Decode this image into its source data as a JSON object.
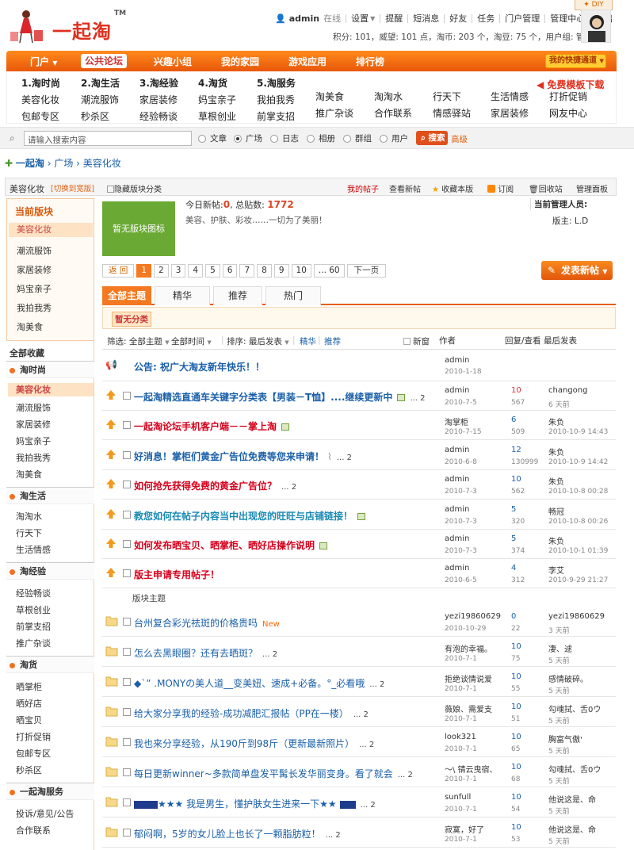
{
  "diy": "DIY",
  "logo": {
    "text": "一起淘",
    "tm": "TM"
  },
  "topbar": {
    "username": "admin",
    "status": "在线",
    "links": [
      "设置",
      "提醒",
      "短消息",
      "好友",
      "任务",
      "门户管理",
      "管理中心",
      "退出"
    ]
  },
  "userline": "积分: 101，威望: 101 点，淘币: 203 个，淘豆: 75 个，用户组: 管理员",
  "nav": {
    "items": [
      "门户",
      "公共论坛",
      "兴趣小组",
      "我的家园",
      "游戏应用",
      "排行榜"
    ],
    "quick": "我的快捷通道"
  },
  "subnav": {
    "cols": [
      {
        "title": "1.淘时尚",
        "items": [
          "美容化妆",
          "包邮专区"
        ]
      },
      {
        "title": "2.淘生活",
        "items": [
          "潮流服饰",
          "秒杀区"
        ]
      },
      {
        "title": "3.淘经验",
        "items": [
          "家居装修",
          "经验畅谈"
        ]
      },
      {
        "title": "4.淘货",
        "items": [
          "妈宝亲子",
          "草根创业"
        ]
      },
      {
        "title": "5.淘服务",
        "items": [
          "我拍我秀",
          "前掌支招"
        ]
      },
      {
        "title": "",
        "items": [
          "淘美食",
          "推广杂谈"
        ]
      },
      {
        "title": "",
        "items": [
          "淘淘水",
          "合作联系"
        ]
      },
      {
        "title": "",
        "items": [
          "行天下",
          "情感驿站"
        ]
      },
      {
        "title": "",
        "items": [
          "生活情感",
          "家居装修"
        ]
      },
      {
        "title": "",
        "items": [
          "打折促销",
          "网友中心"
        ]
      }
    ],
    "freetpl": "免费模板下载"
  },
  "search": {
    "placeholder": "请输入搜索内容",
    "options": [
      "文章",
      "广场",
      "日志",
      "相册",
      "群组",
      "用户"
    ],
    "selected": "广场",
    "button": "搜索",
    "adv": "高级"
  },
  "breadcrumb": {
    "home": "一起淘",
    "parts": [
      "广场",
      "美容化妆"
    ]
  },
  "board": {
    "name": "美容化妆",
    "switch": "[切换到宽版]",
    "hide": "隐藏版块分类",
    "links": [
      "我的帖子",
      "查看新帖",
      "收藏本版",
      "订阅",
      "回收站",
      "管理面板"
    ]
  },
  "left": {
    "cur_title": "当前版块",
    "cur_items": [
      "美容化妆",
      "潮流服饰",
      "家居装修",
      "妈宝亲子",
      "我拍我秀",
      "淘美食"
    ],
    "fav": "全部收藏",
    "sections": [
      {
        "name": "淘时尚",
        "items": [
          "美容化妆",
          "潮流服饰",
          "家居装修",
          "妈宝亲子",
          "我拍我秀",
          "淘美食"
        ]
      },
      {
        "name": "淘生活",
        "items": [
          "淘淘水",
          "行天下",
          "生活情感"
        ]
      },
      {
        "name": "淘经验",
        "items": [
          "经验畅谈",
          "草根创业",
          "前掌支招",
          "推广杂谈"
        ]
      },
      {
        "name": "淘货",
        "items": [
          "晒掌柜",
          "晒好店",
          "晒宝贝",
          "打折促销",
          "包邮专区",
          "秒杀区"
        ]
      },
      {
        "name": "一起淘服务",
        "items": [
          "投诉/意见/公告",
          "合作联系"
        ]
      }
    ]
  },
  "forum": {
    "logo_text": "暂无版块图标",
    "today_label": "今日新帖:",
    "today": "0",
    "total_label": ", 总贴数:",
    "total": "1772",
    "desc": "美容、护肤、彩妆……一切为了美丽！",
    "admins_title": "当前管理人员:",
    "admins": "版主: L.D"
  },
  "pager": {
    "prev": "返 回",
    "pages": [
      "1",
      "2",
      "3",
      "4",
      "5",
      "6",
      "7",
      "8",
      "9",
      "10",
      "... 60"
    ],
    "next": "下一页",
    "current": "1"
  },
  "newpost": "发表新帖",
  "tabs": [
    "全部主题",
    "精华",
    "推荐",
    "热门"
  ],
  "noclass": "暂无分类",
  "filter": {
    "f1": "筛选: 全部主题",
    "f2": "全部时间",
    "sort": "排序: 最后发表",
    "jh": "精华",
    "tj": "推荐",
    "newwin": "新窗",
    "author": "作者",
    "replies": "回复/查看",
    "last": "最后发表"
  },
  "announce": {
    "title": "公告: 祝广大淘友新年快乐！！",
    "author": "admin",
    "date": "2010-1-18"
  },
  "sticky": [
    {
      "title": "一起淘精选直通车关键字分类表【男装－T恤】....继续更新中",
      "pg": "... 2",
      "img": true,
      "author": "admin",
      "date": "2010-7-5",
      "rep": "10",
      "view": "567",
      "last": "changong",
      "lastd": "6 天前",
      "style": "blue"
    },
    {
      "title": "一起淘论坛手机客户端－－掌上淘",
      "pg": "",
      "img": true,
      "author": "淘掌柜",
      "date": "2010-7-15",
      "rep": "6",
      "view": "509",
      "last": "朱负",
      "lastd": "2010-10-9 14:43",
      "style": "red"
    },
    {
      "title": "好消息！掌柜们黄金广告位免费等您来申请！",
      "pg": "... 2",
      "img": false,
      "clip": true,
      "author": "admin",
      "date": "2010-6-8",
      "rep": "12",
      "view": "130999",
      "last": "朱负",
      "lastd": "2010-10-9 14:42",
      "style": "blue"
    },
    {
      "title": "如何抢先获得免费的黄金广告位？",
      "pg": "... 2",
      "img": false,
      "author": "admin",
      "date": "2010-7-3",
      "rep": "10",
      "view": "562",
      "last": "朱负",
      "lastd": "2010-10-8 00:28",
      "style": "red"
    },
    {
      "title": "教您如何在帖子内容当中出现您的旺旺与店铺链接！",
      "pg": "",
      "img": true,
      "author": "admin",
      "date": "2010-7-3",
      "rep": "5",
      "view": "320",
      "last": "畅冠",
      "lastd": "2010-10-8 00:26",
      "style": "blue2"
    },
    {
      "title": "如何发布晒宝贝、晒掌柜、晒好店操作说明",
      "pg": "",
      "img": true,
      "author": "admin",
      "date": "2010-7-3",
      "rep": "5",
      "view": "374",
      "last": "朱负",
      "lastd": "2010-10-1 01:39",
      "style": "red"
    },
    {
      "title": "版主申请专用帖子！",
      "pg": "",
      "img": false,
      "author": "admin",
      "date": "2010-6-5",
      "rep": "4",
      "view": "312",
      "last": "李艾",
      "lastd": "2010-9-29 21:27",
      "style": "red"
    }
  ],
  "section_label": "版块主题",
  "threads": [
    {
      "title": "台州复合彩光祛斑的价格贵吗",
      "new": "New",
      "pg": "",
      "author": "yezi19860629",
      "date": "2010-10-29",
      "rep": "0",
      "view": "22",
      "last": "yezi19860629",
      "lastd": "3 天前"
    },
    {
      "title": "怎么去黑眼圈？还有去晒斑？",
      "pg": "... 2",
      "author": "有泡的幸福。",
      "date": "2010-7-1",
      "rep": "10",
      "view": "75",
      "last": "凄、逑",
      "lastd": "5 天前"
    },
    {
      "title": "◆ˋ” .MONYの美人道__变美妞、速成+必备。°_必看哦",
      "pg": "... 2",
      "author": "拒绝谈情说爱",
      "date": "2010-7-1",
      "rep": "10",
      "view": "55",
      "last": "感情破碎。",
      "lastd": "5 天前"
    },
    {
      "title": "给大家分享我的经验-成功减肥汇报帖（PP在一楼）",
      "pg": "... 2",
      "author": "薇娘、需爱支",
      "date": "2010-7-1",
      "rep": "10",
      "view": "51",
      "last": "勾魂拭、舌0ウ",
      "lastd": "5 天前"
    },
    {
      "title": "我也来分享经验，从190斤到98斤（更新最新照片）",
      "pg": "... 2",
      "author": "look321",
      "date": "2010-7-1",
      "rep": "10",
      "view": "65",
      "last": "胸富气傲'",
      "lastd": "5 天前"
    },
    {
      "title": "每日更新winner~多款简单盘发平髯长发华丽变身。看了就会",
      "pg": "... 2",
      "author": "〜\\ 锖云曳宿、",
      "date": "2010-7-1",
      "rep": "10",
      "view": "68",
      "last": "勾魂拭、舌0ウ",
      "lastd": "5 天前"
    },
    {
      "title": "★★★ 我是男生，懂护肤女生进来一下★★",
      "pg": "... 2",
      "blocks": true,
      "author": "sunfull",
      "date": "2010-7-1",
      "rep": "10",
      "view": "54",
      "last": "他说这是、命",
      "lastd": "5 天前"
    },
    {
      "title": "郁闷啊，5岁的女儿脸上也长了一颗脂肪粒！",
      "pg": "... 2",
      "author": "寂寞，好了",
      "date": "2010-7-1",
      "rep": "10",
      "view": "53",
      "last": "他说这是、命",
      "lastd": "5 天前"
    }
  ]
}
